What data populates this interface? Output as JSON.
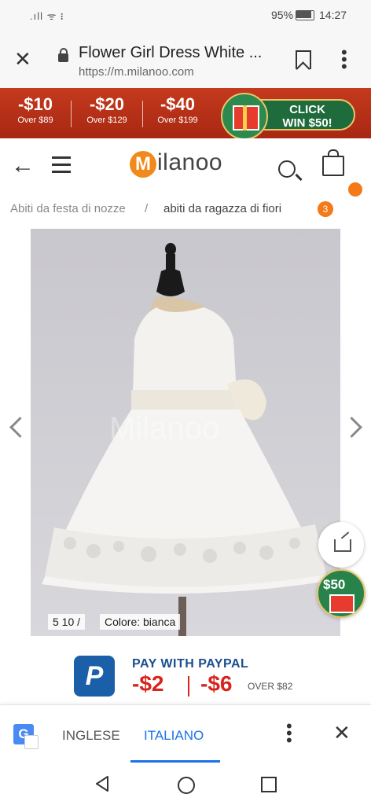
{
  "status_bar": {
    "signal": ".ıll ᯤ ᎒",
    "battery": "95%",
    "time": "14:27"
  },
  "browser": {
    "title": "Flower Girl Dress White ...",
    "url": "https://m.milanoo.com"
  },
  "promo": {
    "deals": [
      {
        "amount": "-$10",
        "condition": "Over $89"
      },
      {
        "amount": "-$20",
        "condition": "Over $129"
      },
      {
        "amount": "-$40",
        "condition": "Over $199"
      }
    ],
    "cta_line1": "CLICK",
    "cta_line2": "WIN $50!"
  },
  "site": {
    "logo_mark": "M",
    "logo_text": "ilanoo"
  },
  "breadcrumb": {
    "item1": "Abiti da festa di nozze",
    "separator": "/",
    "item2": "abiti da ragazza di fiori",
    "count": "3"
  },
  "product": {
    "counter": "5 10 /",
    "color_label": "Colore: bianca",
    "watermark": "Milanoo"
  },
  "floating": {
    "gift_label": "$50"
  },
  "paypal": {
    "logo": "P",
    "headline": "PAY WITH PAYPAL",
    "discount1": "-$2",
    "discount2": "-$6",
    "threshold": "OVER $82"
  },
  "translate": {
    "lang1": "INGLESE",
    "lang2": "ITALIANO"
  },
  "icons": [
    "wifi-icon",
    "battery-icon",
    "close-icon",
    "lock-icon",
    "bookmark-icon",
    "more-icon",
    "back-arrow-icon",
    "menu-icon",
    "search-icon",
    "bag-icon",
    "chevron-left-icon",
    "chevron-right-icon",
    "share-icon",
    "gift-icon",
    "google-translate-icon",
    "nav-back-icon",
    "nav-home-icon",
    "nav-recents-icon"
  ],
  "colors": {
    "promo_red": "#b8301a",
    "brand_orange": "#f08a1c",
    "translate_blue": "#1a73e8",
    "paypal_blue": "#1b5fa8",
    "discount_red": "#d8241c"
  }
}
